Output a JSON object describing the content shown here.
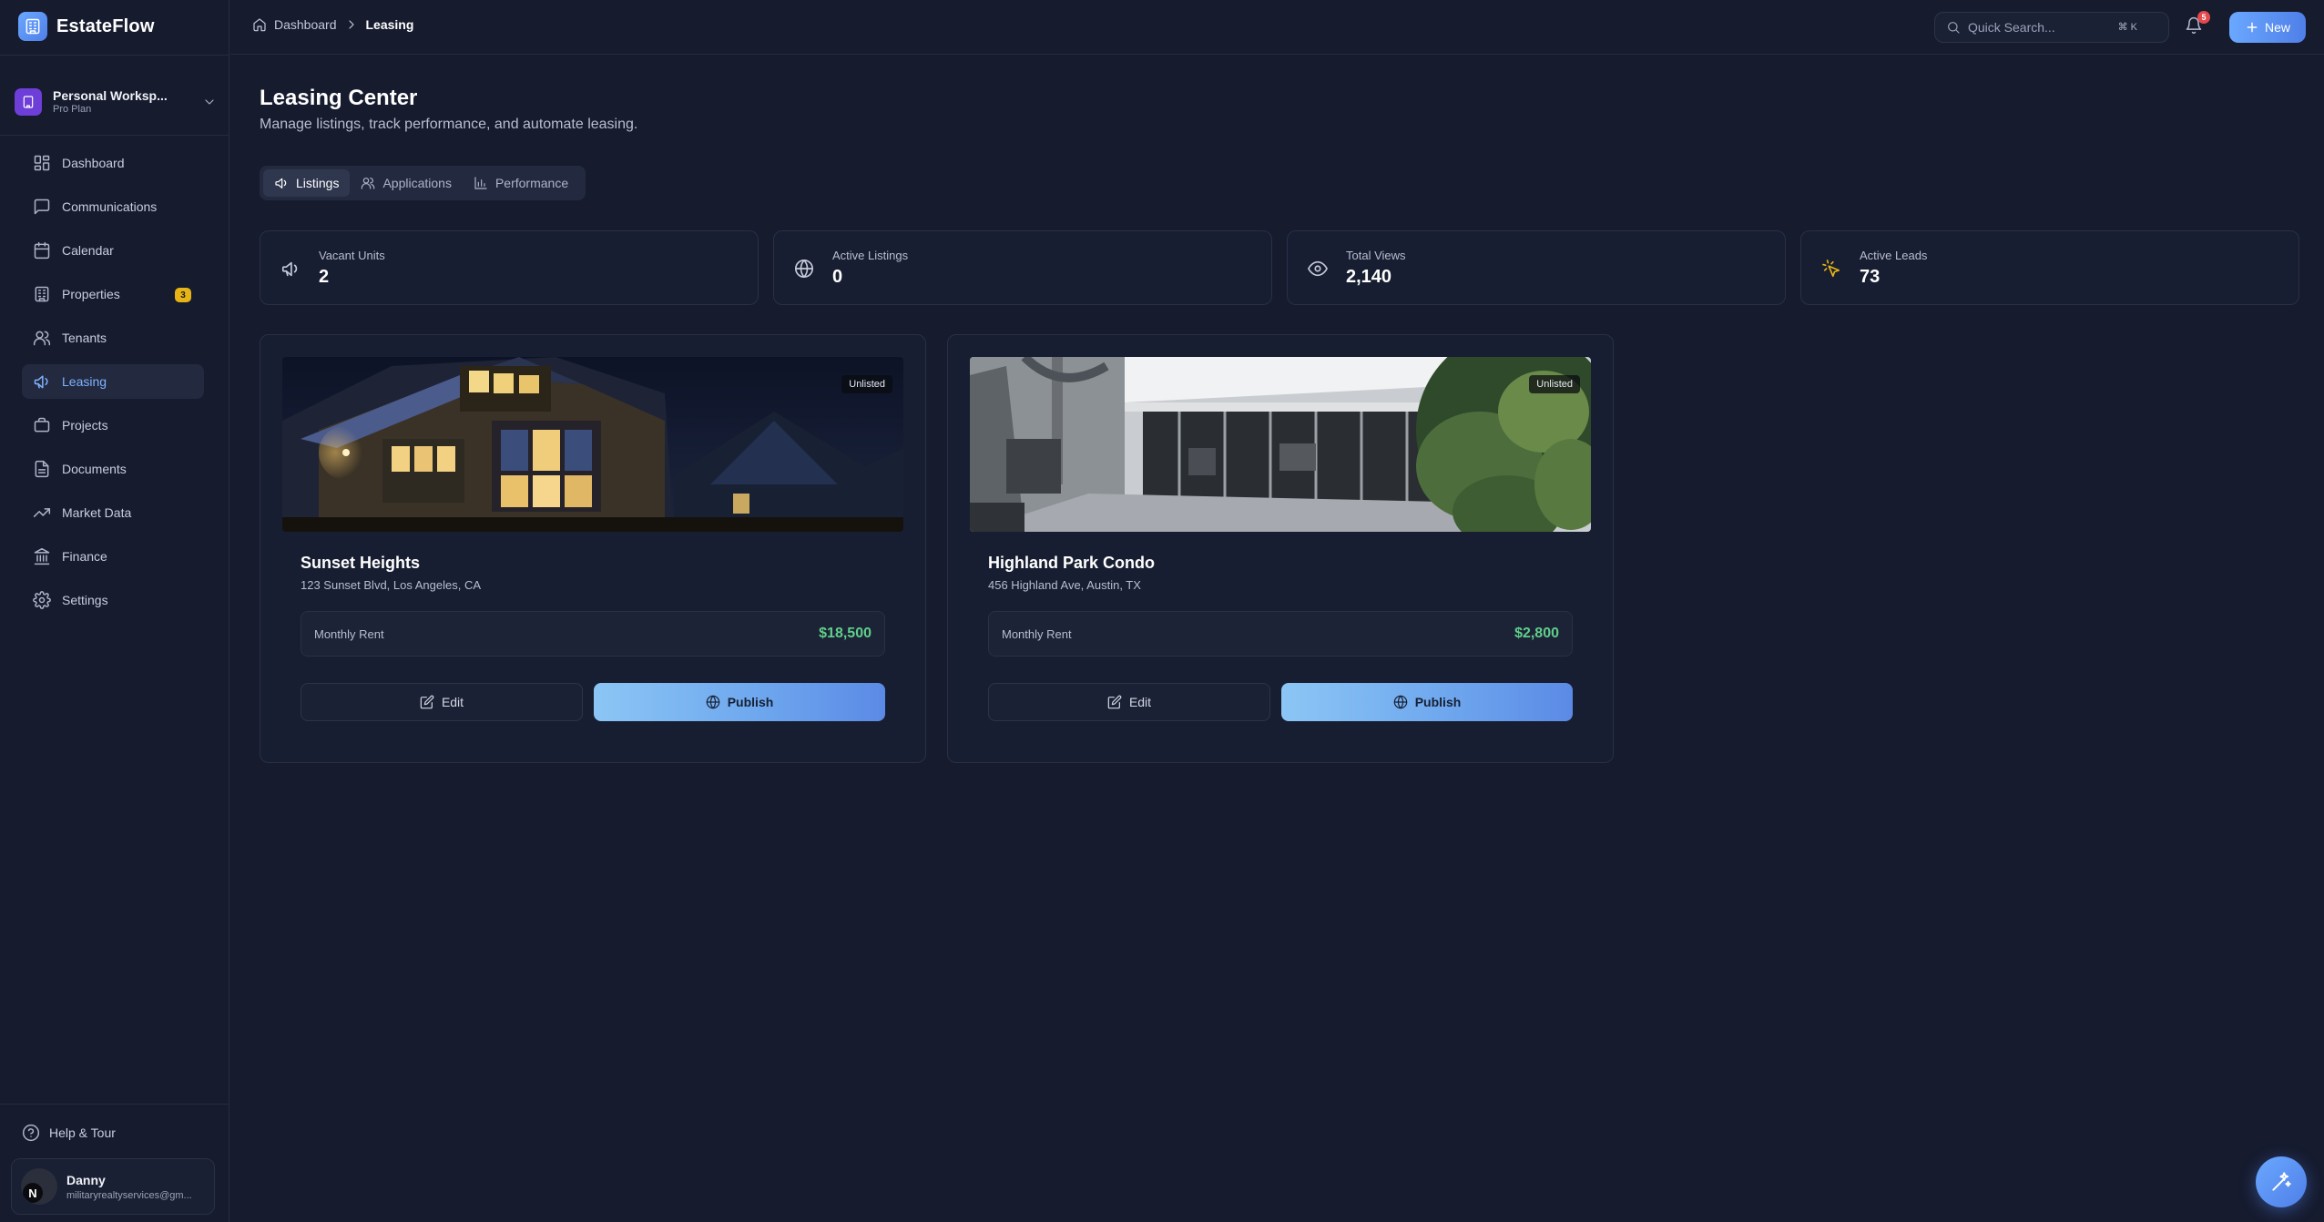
{
  "brand": {
    "name": "EstateFlow",
    "icon": "building-icon"
  },
  "workspace": {
    "name": "Personal Worksp...",
    "plan": "Pro Plan"
  },
  "sidebar": {
    "items": [
      {
        "label": "Dashboard",
        "icon": "grid-icon"
      },
      {
        "label": "Communications",
        "icon": "message-square-icon"
      },
      {
        "label": "Calendar",
        "icon": "calendar-icon"
      },
      {
        "label": "Properties",
        "icon": "building-icon",
        "badge": "3"
      },
      {
        "label": "Tenants",
        "icon": "users-icon"
      },
      {
        "label": "Leasing",
        "icon": "megaphone-icon",
        "active": true
      },
      {
        "label": "Projects",
        "icon": "briefcase-icon"
      },
      {
        "label": "Documents",
        "icon": "file-text-icon"
      },
      {
        "label": "Market Data",
        "icon": "trending-up-icon"
      },
      {
        "label": "Finance",
        "icon": "landmark-icon"
      },
      {
        "label": "Settings",
        "icon": "gear-icon"
      }
    ],
    "help_label": "Help & Tour",
    "user": {
      "name": "Danny",
      "email": "militaryrealtyservices@gm...",
      "avatar_initial": "N"
    }
  },
  "topbar": {
    "breadcrumb": {
      "home": "Dashboard",
      "current": "Leasing"
    },
    "search": {
      "placeholder": "Quick Search...",
      "shortcut": "⌘ K"
    },
    "notifications_count": "5",
    "new_label": "New"
  },
  "page": {
    "title": "Leasing Center",
    "subtitle": "Manage listings, track performance, and automate leasing."
  },
  "tabs": [
    {
      "label": "Listings",
      "icon": "megaphone-icon",
      "active": true
    },
    {
      "label": "Applications",
      "icon": "users-icon"
    },
    {
      "label": "Performance",
      "icon": "bar-chart-icon"
    }
  ],
  "stats": [
    {
      "label": "Vacant Units",
      "value": "2",
      "icon": "megaphone-icon"
    },
    {
      "label": "Active Listings",
      "value": "0",
      "icon": "globe-icon"
    },
    {
      "label": "Total Views",
      "value": "2,140",
      "icon": "eye-icon"
    },
    {
      "label": "Active Leads",
      "value": "73",
      "icon": "cursor-click-icon",
      "icon_color": "#e7b416"
    }
  ],
  "listings": [
    {
      "name": "Sunset Heights",
      "address": "123 Sunset Blvd, Los Angeles, CA",
      "status": "Unlisted",
      "rent_label": "Monthly Rent",
      "rent": "$18,500",
      "edit_label": "Edit",
      "publish_label": "Publish"
    },
    {
      "name": "Highland Park Condo",
      "address": "456 Highland Ave, Austin, TX",
      "status": "Unlisted",
      "rent_label": "Monthly Rent",
      "rent": "$2,800",
      "edit_label": "Edit",
      "publish_label": "Publish"
    }
  ],
  "colors": {
    "background": "#161b2e",
    "accent": "#5b8ae6",
    "rent_green": "#5fcf8a",
    "badge_yellow": "#e7b416",
    "notification_red": "#e5484d"
  }
}
